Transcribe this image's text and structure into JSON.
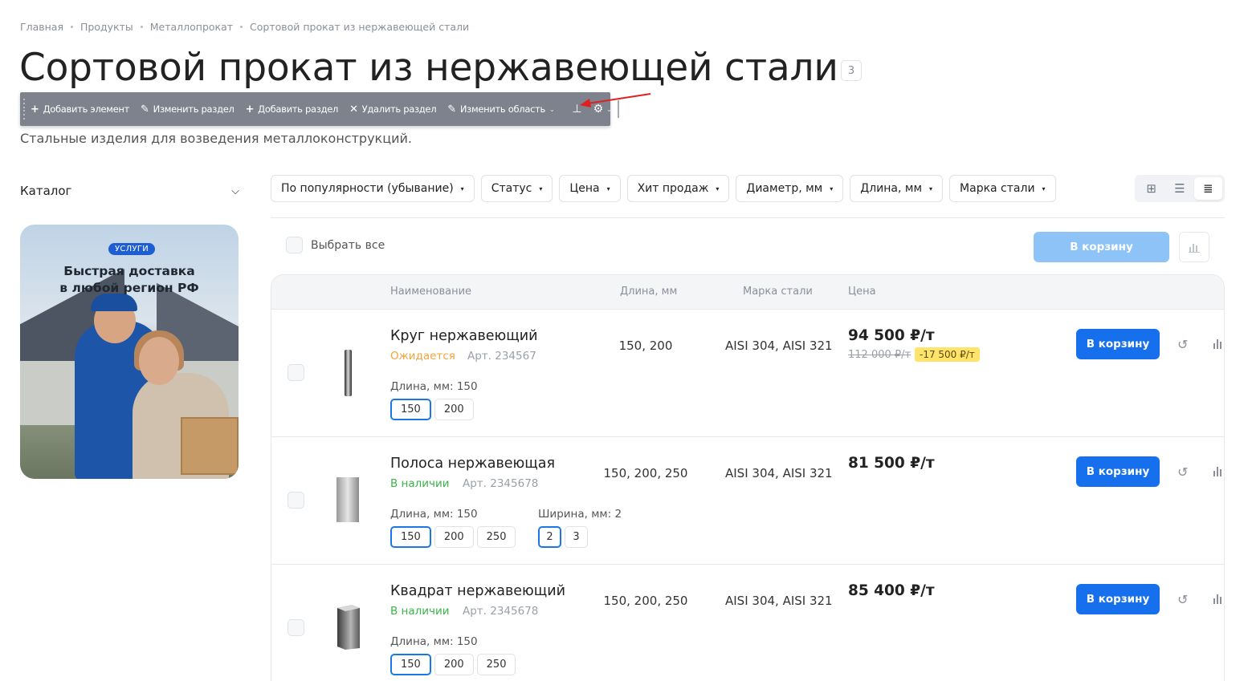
{
  "breadcrumb": [
    "Главная",
    "Продукты",
    "Металлопрокат",
    "Сортовой прокат из нержавеющей стали"
  ],
  "page": {
    "title": "Сортовой прокат из нержавеющей стали",
    "count": "3",
    "subtitle": "Стальные изделия для возведения металлоконструкций."
  },
  "admin_toolbar": {
    "add_element": "Добавить элемент",
    "edit_section": "Изменить раздел",
    "add_section": "Добавить раздел",
    "delete_section": "Удалить раздел",
    "edit_area": "Изменить область"
  },
  "sidebar": {
    "catalog_label": "Каталог",
    "banner": {
      "tag": "УСЛУГИ",
      "title_line1": "Быстрая доставка",
      "title_line2": "в любой регион РФ"
    }
  },
  "filters": [
    "По популярности (убывание)",
    "Статус",
    "Цена",
    "Хит продаж",
    "Диаметр, мм",
    "Длина, мм",
    "Марка стали"
  ],
  "list_controls": {
    "select_all": "Выбрать все",
    "cart_button": "В корзину"
  },
  "table": {
    "headers": {
      "name": "Наименование",
      "length": "Длина, мм",
      "steel": "Марка стали",
      "price": "Цена"
    },
    "rows": [
      {
        "name": "Круг нержавеющий",
        "status": "Ожидается",
        "article": "Арт. 234567",
        "length_label": "Длина, мм: 150",
        "length_options": [
          "150",
          "200"
        ],
        "lengths": "150, 200",
        "steel": "AISI 304, AISI 321",
        "price": "94 500 ₽/т",
        "old_price": "112 000 ₽/т",
        "discount": "-17 500 ₽/т",
        "cart": "В корзину"
      },
      {
        "name": "Полоса нержавеющая",
        "status": "В наличии",
        "article": "Арт. 2345678",
        "length_label": "Длина, мм: 150",
        "length_options": [
          "150",
          "200",
          "250"
        ],
        "width_label": "Ширина, мм: 2",
        "width_options": [
          "2",
          "3"
        ],
        "lengths": "150, 200, 250",
        "steel": "AISI 304, AISI 321",
        "price": "81 500 ₽/т",
        "cart": "В корзину"
      },
      {
        "name": "Квадрат нержавеющий",
        "status": "В наличии",
        "article": "Арт. 2345678",
        "length_label": "Длина, мм: 150",
        "length_options": [
          "150",
          "200",
          "250"
        ],
        "lengths": "150, 200, 250",
        "steel": "AISI 304, AISI 321",
        "price": "85 400 ₽/т",
        "cart": "В корзину"
      }
    ]
  },
  "colors": {
    "primary": "#1670ee",
    "primary_disabled": "#8ec3f7",
    "status_waiting": "#f3a33d",
    "status_in_stock": "#39b54a",
    "discount_bg": "#ffe36a",
    "toolbar_bg": "#7d828c"
  }
}
